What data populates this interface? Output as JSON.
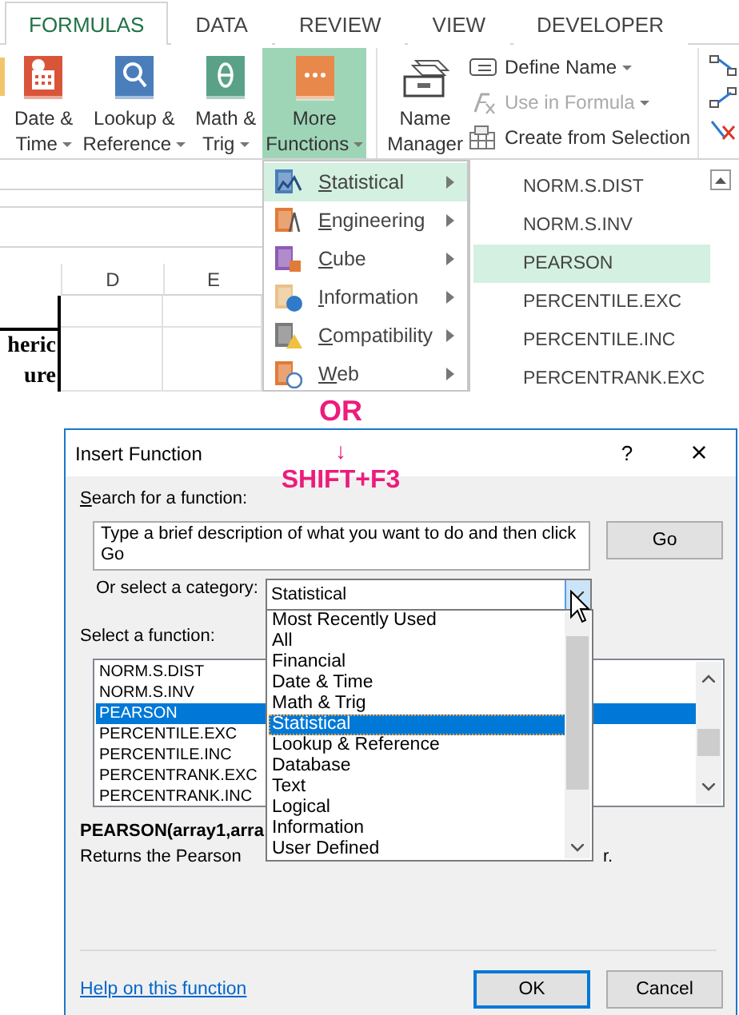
{
  "ribbon_tabs": [
    {
      "label": "FORMULAS",
      "selected": true
    },
    {
      "label": "DATA",
      "selected": false
    },
    {
      "label": "REVIEW",
      "selected": false
    },
    {
      "label": "VIEW",
      "selected": false
    },
    {
      "label": "DEVELOPER",
      "selected": false
    }
  ],
  "ribbon_buttons": [
    {
      "kind": "date",
      "lines": [
        "Date &",
        "Time"
      ],
      "dropdown": true,
      "selected": false
    },
    {
      "kind": "lookup",
      "lines": [
        "Lookup &",
        "Reference"
      ],
      "dropdown": true,
      "selected": false
    },
    {
      "kind": "math",
      "lines": [
        "Math &",
        "Trig"
      ],
      "dropdown": true,
      "selected": false
    },
    {
      "kind": "more",
      "lines": [
        "More",
        "Functions"
      ],
      "dropdown": true,
      "selected": true
    }
  ],
  "name_manager": {
    "lines": [
      "Name",
      "Manager"
    ]
  },
  "name_commands": [
    {
      "kind": "define",
      "label": "Define Name",
      "dropdown": true,
      "disabled": false
    },
    {
      "kind": "use",
      "label": "Use in Formula",
      "dropdown": true,
      "disabled": true
    },
    {
      "kind": "create",
      "label": "Create from Selection",
      "dropdown": false,
      "disabled": false
    }
  ],
  "sheet": {
    "columns": [
      "D",
      "E"
    ],
    "cell_lines": [
      "heric",
      "ure"
    ]
  },
  "more_functions_menu": [
    {
      "kind": "statistical",
      "label": "Statistical",
      "selected": true
    },
    {
      "kind": "engineering",
      "label": "Engineering",
      "selected": false
    },
    {
      "kind": "cube",
      "label": "Cube",
      "selected": false
    },
    {
      "kind": "information",
      "label": "Information",
      "selected": false
    },
    {
      "kind": "compatibility",
      "label": "Compatibility",
      "selected": false
    },
    {
      "kind": "web",
      "label": "Web",
      "selected": false
    }
  ],
  "function_submenu": [
    {
      "label": "NORM.S.DIST",
      "selected": false
    },
    {
      "label": "NORM.S.INV",
      "selected": false
    },
    {
      "label": "PEARSON",
      "selected": true
    },
    {
      "label": "PERCENTILE.EXC",
      "selected": false
    },
    {
      "label": "PERCENTILE.INC",
      "selected": false
    },
    {
      "label": "PERCENTRANK.EXC",
      "selected": false
    }
  ],
  "annotation": {
    "or": "OR",
    "arrow": "↓",
    "shortcut": "SHIFT+F3"
  },
  "dialog": {
    "title": "Insert Function",
    "help": "?",
    "close": "×",
    "search_label": "Search for a function:",
    "search": {
      "value": "Type a brief description of what you want to do and then click Go"
    },
    "go": "Go",
    "category_label": "Or select a category:",
    "category": {
      "value": "Statistical"
    },
    "category_options": [
      {
        "label": "Most Recently Used",
        "selected": false
      },
      {
        "label": "All",
        "selected": false
      },
      {
        "label": "Financial",
        "selected": false
      },
      {
        "label": "Date & Time",
        "selected": false
      },
      {
        "label": "Math & Trig",
        "selected": false
      },
      {
        "label": "Statistical",
        "selected": true
      },
      {
        "label": "Lookup & Reference",
        "selected": false
      },
      {
        "label": "Database",
        "selected": false
      },
      {
        "label": "Text",
        "selected": false
      },
      {
        "label": "Logical",
        "selected": false
      },
      {
        "label": "Information",
        "selected": false
      },
      {
        "label": "User Defined",
        "selected": false
      }
    ],
    "function_label": "Select a function:",
    "functions": [
      {
        "label": "NORM.S.DIST",
        "selected": false
      },
      {
        "label": "NORM.S.INV",
        "selected": false
      },
      {
        "label": "PEARSON",
        "selected": true
      },
      {
        "label": "PERCENTILE.EXC",
        "selected": false
      },
      {
        "label": "PERCENTILE.INC",
        "selected": false
      },
      {
        "label": "PERCENTRANK.EXC",
        "selected": false
      },
      {
        "label": "PERCENTRANK.INC",
        "selected": false
      }
    ],
    "syntax": "PEARSON(array1,arra",
    "description": [
      "Returns the Pearson",
      "r."
    ],
    "help_link": "Help on this function",
    "ok": "OK",
    "cancel": "Cancel"
  }
}
